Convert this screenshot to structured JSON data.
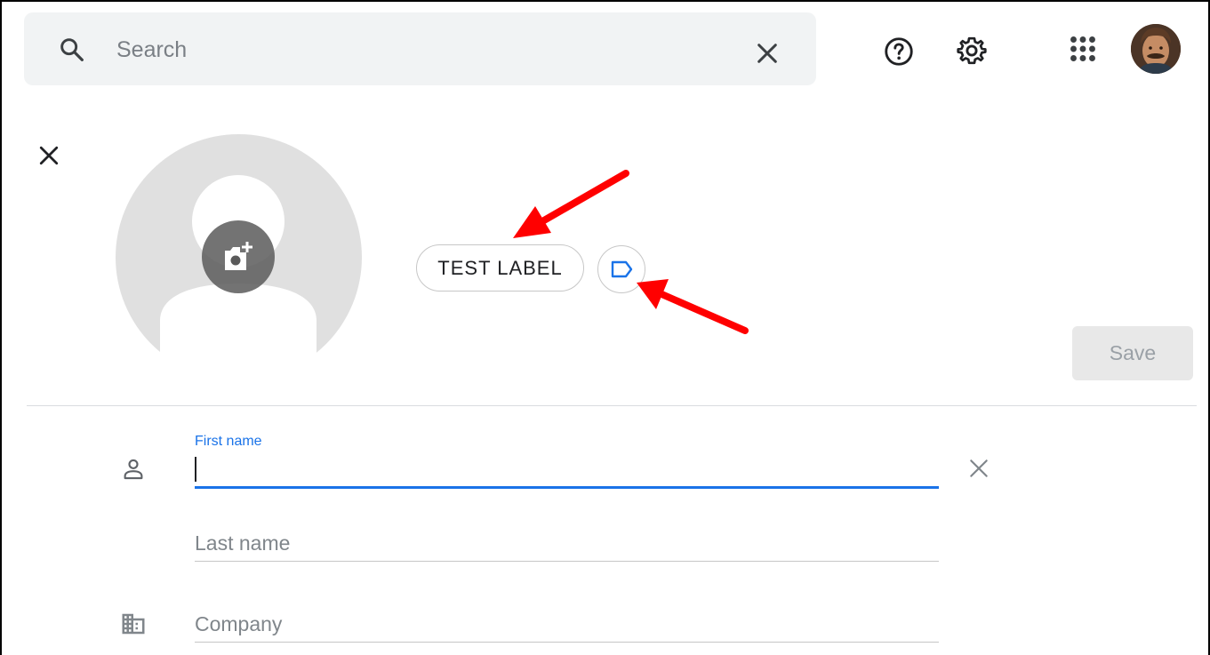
{
  "search": {
    "placeholder": "Search",
    "icon": "search-icon",
    "clear_icon": "close-icon"
  },
  "header": {
    "help_icon": "help-icon",
    "settings_icon": "gear-icon",
    "apps_icon": "apps-grid-icon",
    "avatar_icon": "account-avatar"
  },
  "contact": {
    "close_icon": "close-icon",
    "photo_icon": "add-photo-icon",
    "label_chip": "TEST LABEL",
    "label_icon": "label-icon",
    "save_label": "Save"
  },
  "form": {
    "first_name_label": "First name",
    "first_name_value": "",
    "last_name_placeholder": "Last name",
    "company_placeholder": "Company",
    "person_icon": "person-icon",
    "company_icon": "building-icon"
  },
  "colors": {
    "accent": "#1a73e8",
    "annotation_arrow": "#ff0000",
    "search_bg": "#f1f3f4"
  }
}
